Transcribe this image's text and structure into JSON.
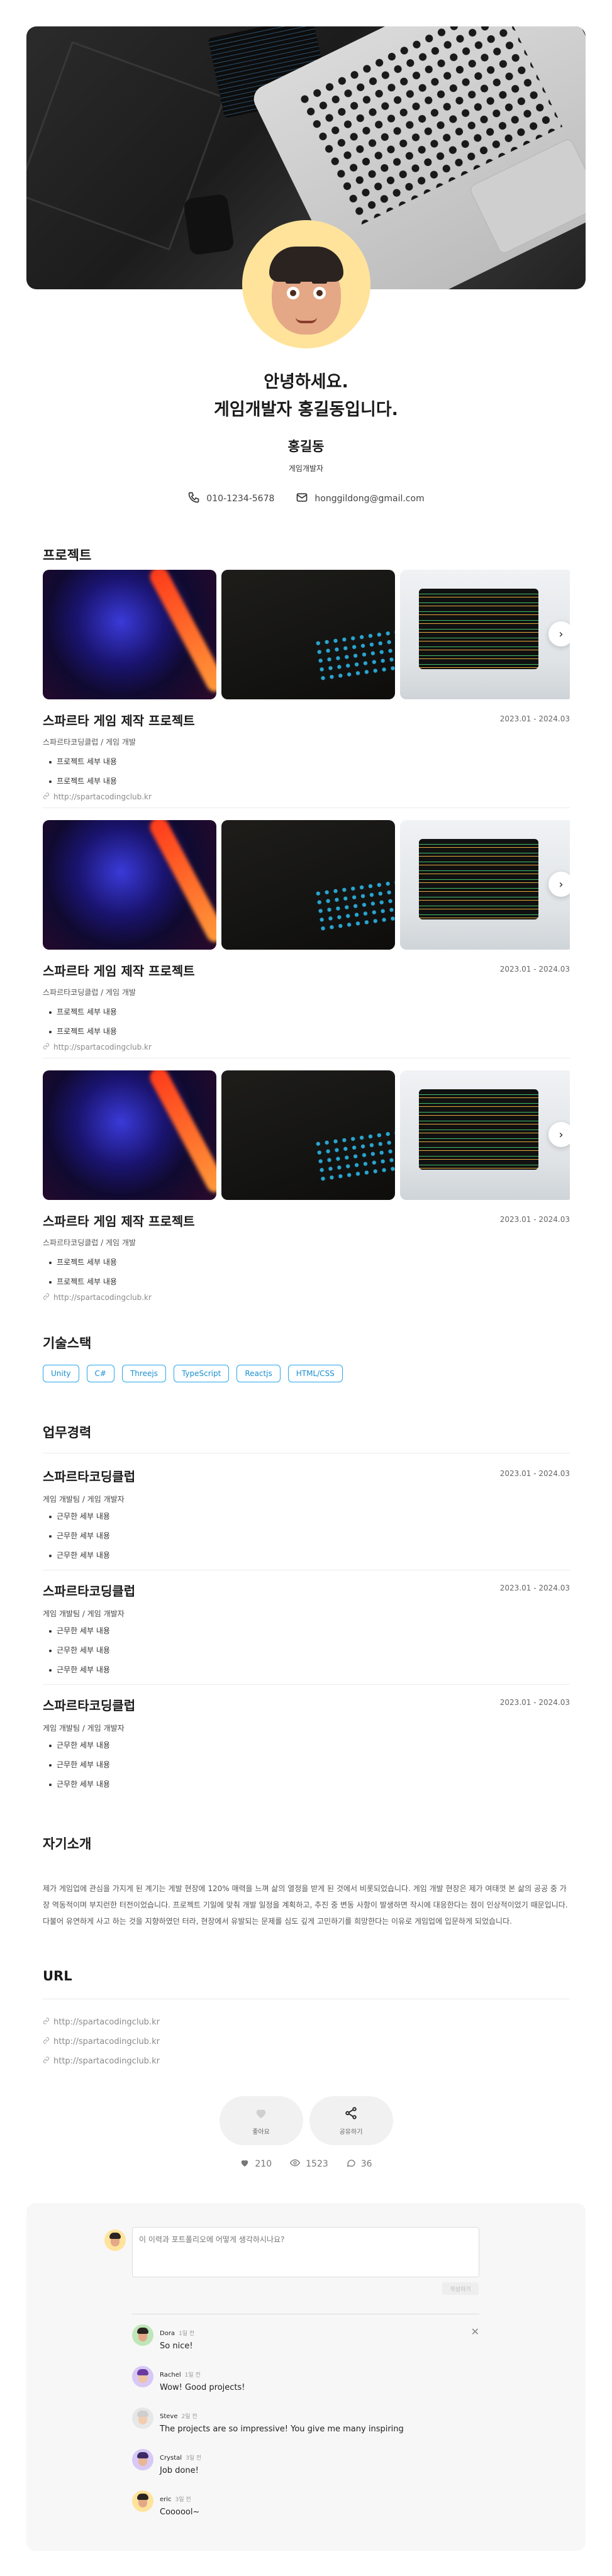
{
  "intro": {
    "greeting": "안녕하세요.",
    "headline": "게임개발자 홍길동입니다.",
    "name": "홍길동",
    "role": "게임개발자",
    "phone": "010-1234-5678",
    "email": "honggildong@gmail.com"
  },
  "sections": {
    "projects": "프로젝트",
    "skills": "기술스택",
    "career": "업무경력",
    "about": "자기소개",
    "url": "URL"
  },
  "projects": [
    {
      "title": "스파르타 게임 제작 프로젝트",
      "date": "2023.01 - 2024.03",
      "org": "스파르타코딩클럽 / 게임 개발",
      "bullets": [
        "프로젝트 세부 내용",
        "프로젝트 세부 내용"
      ],
      "link": "http://spartacodingclub.kr"
    },
    {
      "title": "스파르타 게임 제작 프로젝트",
      "date": "2023.01 - 2024.03",
      "org": "스파르타코딩클럽 / 게임 개발",
      "bullets": [
        "프로젝트 세부 내용",
        "프로젝트 세부 내용"
      ],
      "link": "http://spartacodingclub.kr"
    },
    {
      "title": "스파르타 게임 제작 프로젝트",
      "date": "2023.01 - 2024.03",
      "org": "스파르타코딩클럽 / 게임 개발",
      "bullets": [
        "프로젝트 세부 내용",
        "프로젝트 세부 내용"
      ],
      "link": "http://spartacodingclub.kr"
    }
  ],
  "skills": [
    "Unity",
    "C#",
    "Threejs",
    "TypeScript",
    "Reactjs",
    "HTML/CSS"
  ],
  "career": [
    {
      "title": "스파르타코딩클럽",
      "date": "2023.01 - 2024.03",
      "sub": "게임 개발팀 / 게임 개발자",
      "bullets": [
        "근무한 세부 내용",
        "근무한 세부 내용",
        "근무한 세부 내용"
      ]
    },
    {
      "title": "스파르타코딩클럽",
      "date": "2023.01 - 2024.03",
      "sub": "게임 개발팀 / 게임 개발자",
      "bullets": [
        "근무한 세부 내용",
        "근무한 세부 내용",
        "근무한 세부 내용"
      ]
    },
    {
      "title": "스파르타코딩클럽",
      "date": "2023.01 - 2024.03",
      "sub": "게임 개발팀 / 게임 개발자",
      "bullets": [
        "근무한 세부 내용",
        "근무한 세부 내용",
        "근무한 세부 내용"
      ]
    }
  ],
  "about": "제가 게임업에 관심을 가지게 된 계기는 게발 현장에 120% 매력을 느껴 삶의 열정을 받게 된 것에서 비롯되었습니다. 게임 개발 현장은 제가 여태껏 본 삶의 공공 중 가장 역동적이며 부지런한 터전이었습니다. 프로젝트 기일에 맞춰 개발 일정을 계획하고, 추진 중 변동 사항이 발생하면 작시에 대응한다는 점이 인상적이었기 때문입니다. 다불어 유연하게 사고 하는 것을 지향하였던 터라, 현장에서 유발되는 문제를 심도 깊게 고민하기를 희망한다는 이유로 게임업에 입문하게 되었습니다.",
  "urls": [
    "http://spartacodingclub.kr",
    "http://spartacodingclub.kr",
    "http://spartacodingclub.kr"
  ],
  "actions": {
    "like": "좋아요",
    "share": "공유하기"
  },
  "stats": {
    "likes": "210",
    "views": "1523",
    "comments": "36"
  },
  "comment_form": {
    "placeholder": "이 이력과 포트폴리오에 어떻게 생각하시나요?",
    "submit": "작성하기"
  },
  "comments": [
    {
      "name": "Dora",
      "time": "1일 전",
      "text": "So nice!"
    },
    {
      "name": "Rachel",
      "time": "1일 전",
      "text": "Wow! Good projects!"
    },
    {
      "name": "Steve",
      "time": "2일 전",
      "text": "The projects are so impressive! You give me many inspiring"
    },
    {
      "name": "Crystal",
      "time": "3일 전",
      "text": "Job done!"
    },
    {
      "name": "eric",
      "time": "3일 전",
      "text": "Coooool~"
    }
  ],
  "colors": {
    "accent": "#27a8e8",
    "avatar_bg": "#ffe39b"
  }
}
